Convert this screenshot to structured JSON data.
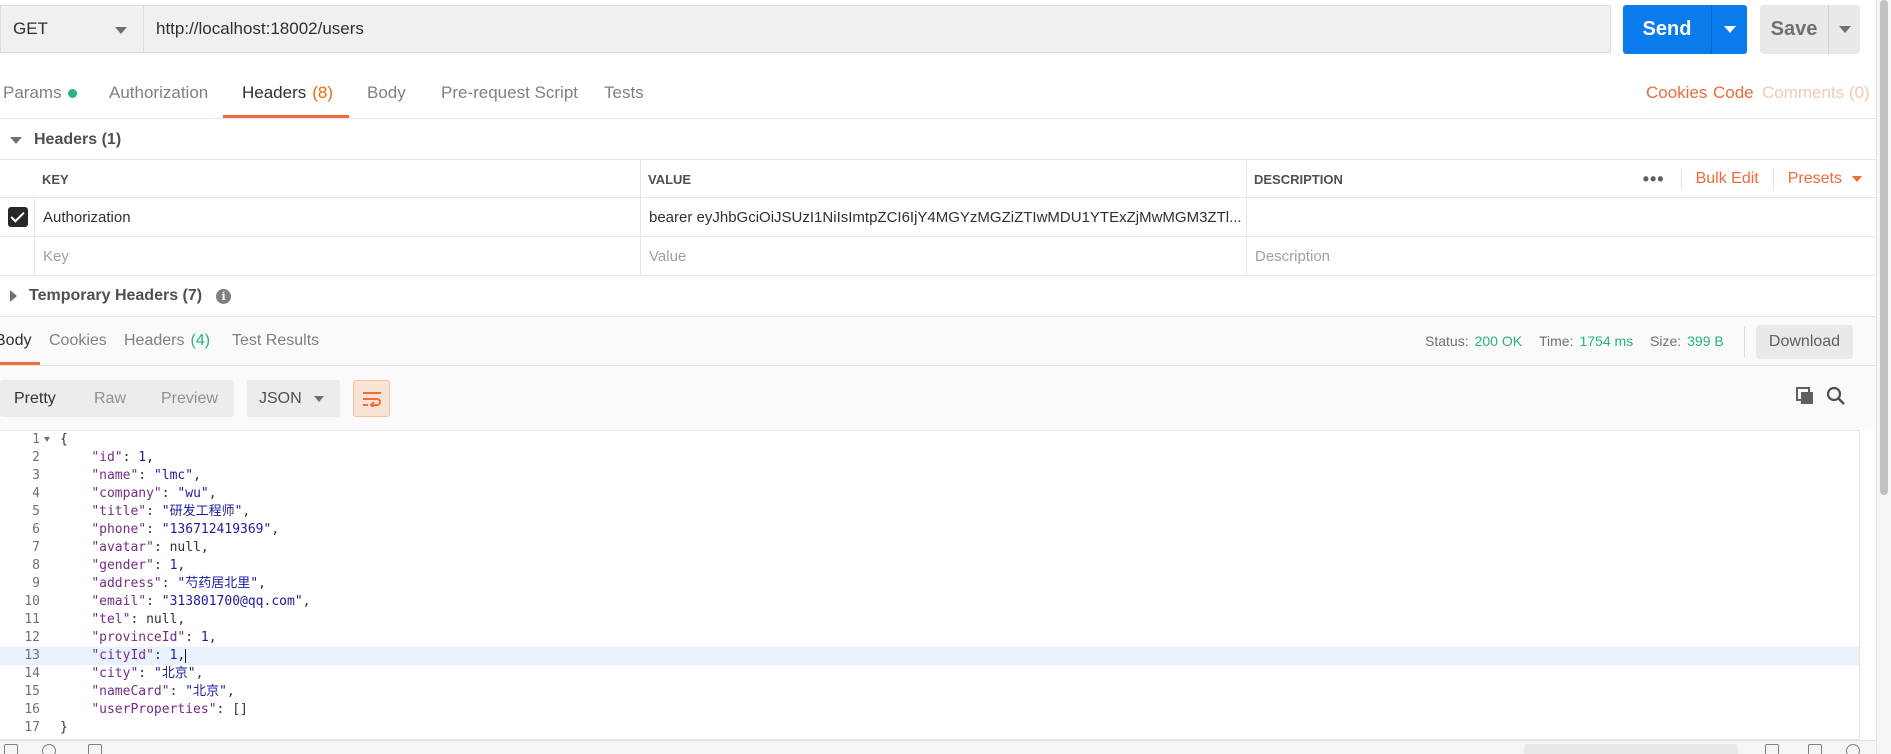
{
  "request": {
    "method": "GET",
    "url": "http://localhost:18002/users",
    "send_label": "Send",
    "save_label": "Save"
  },
  "request_tabs": {
    "params": "Params",
    "authorization": "Authorization",
    "headers": "Headers",
    "headers_count": "(8)",
    "body": "Body",
    "pre_request": "Pre-request Script",
    "tests": "Tests",
    "cookies": "Cookies",
    "code": "Code",
    "comments": "Comments (0)"
  },
  "headers_section": {
    "title": "Headers (1)",
    "columns": {
      "key": "KEY",
      "value": "VALUE",
      "description": "DESCRIPTION"
    },
    "bulk_edit": "Bulk Edit",
    "presets": "Presets",
    "rows": [
      {
        "key": "Authorization",
        "value": "bearer eyJhbGciOiJSUzI1NiIsImtpZCI6IjY4MGYzMGZiZTIwMDU1YTExZjMwMGM3ZTl...",
        "description": ""
      }
    ],
    "placeholders": {
      "key": "Key",
      "value": "Value",
      "description": "Description"
    },
    "temporary_title": "Temporary Headers (7)"
  },
  "response_tabs": {
    "body": "Body",
    "cookies": "Cookies",
    "headers": "Headers",
    "headers_count": "(4)",
    "test_results": "Test Results"
  },
  "response_status": {
    "status_label": "Status:",
    "status_value": "200 OK",
    "time_label": "Time:",
    "time_value": "1754 ms",
    "size_label": "Size:",
    "size_value": "399 B",
    "download": "Download"
  },
  "view_modes": {
    "pretty": "Pretty",
    "raw": "Raw",
    "preview": "Preview",
    "format": "JSON"
  },
  "code_lines": [
    "{",
    "    \"id\": 1,",
    "    \"name\": \"lmc\",",
    "    \"company\": \"wu\",",
    "    \"title\": \"研发工程师\",",
    "    \"phone\": \"136712419369\",",
    "    \"avatar\": null,",
    "    \"gender\": 1,",
    "    \"address\": \"芍药居北里\",",
    "    \"email\": \"313801700@qq.com\",",
    "    \"tel\": null,",
    "    \"provinceId\": 1,",
    "    \"cityId\": 1,",
    "    \"city\": \"北京\",",
    "    \"nameCard\": \"北京\",",
    "    \"userProperties\": []",
    "}"
  ],
  "highlighted_line": 13,
  "colors": {
    "accent": "#f26b3a",
    "send": "#097bed",
    "success": "#26b47f"
  }
}
